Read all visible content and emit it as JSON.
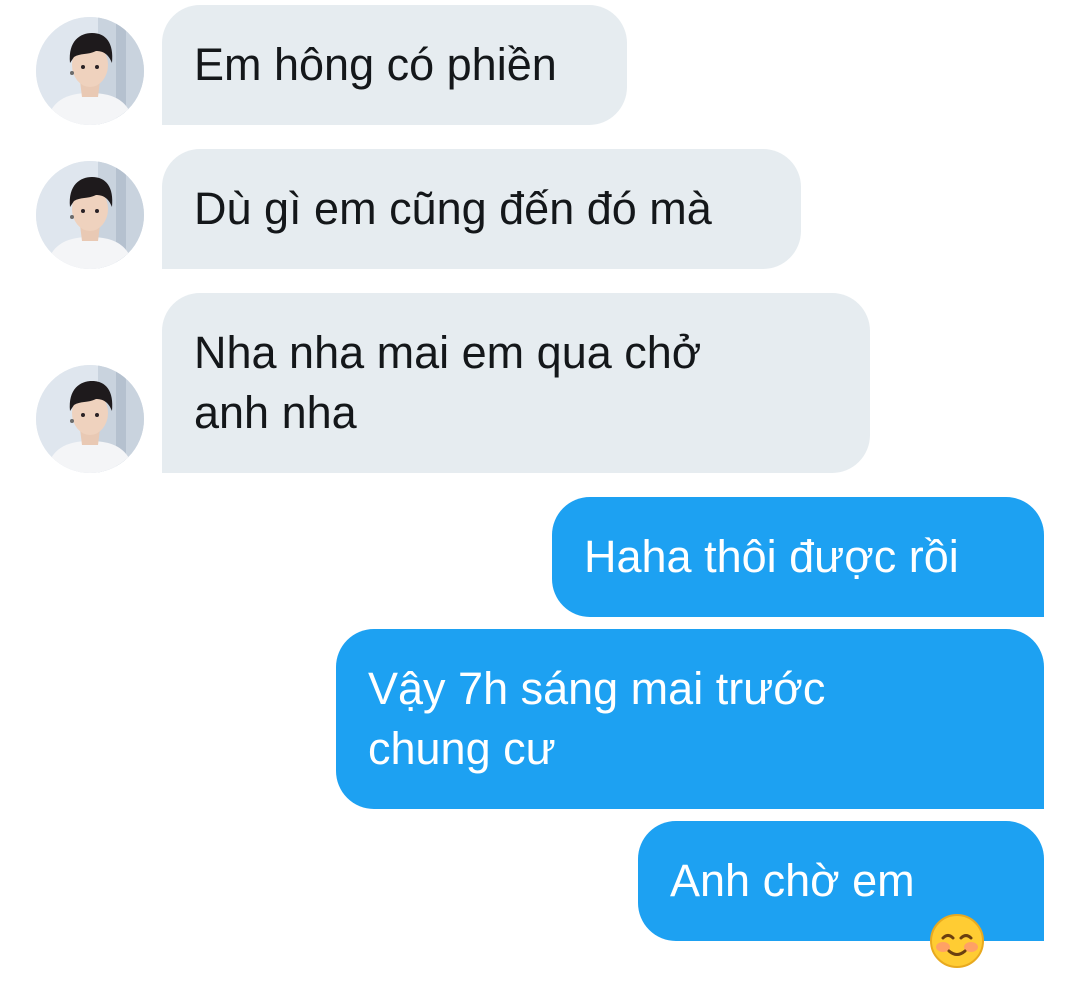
{
  "conversation": {
    "messages": [
      {
        "direction": "received",
        "text": "Em hông có phiền",
        "avatar_icon": "contact-avatar"
      },
      {
        "direction": "received",
        "text": "Dù gì em cũng đến đó mà",
        "avatar_icon": "contact-avatar"
      },
      {
        "direction": "received",
        "text": "Nha nha mai em qua chở\nanh nha",
        "avatar_icon": "contact-avatar"
      },
      {
        "direction": "sent",
        "text": "Haha thôi được rồi"
      },
      {
        "direction": "sent",
        "text": "Vậy 7h sáng mai trước\nchung cư"
      },
      {
        "direction": "sent",
        "text": "Anh chờ em",
        "emoji_icon": "smiling-face-with-blush-emoji"
      }
    ]
  },
  "colors": {
    "received_bubble": "#e6ecf0",
    "received_text": "#14171a",
    "sent_bubble": "#1da1f2",
    "sent_text": "#ffffff"
  }
}
